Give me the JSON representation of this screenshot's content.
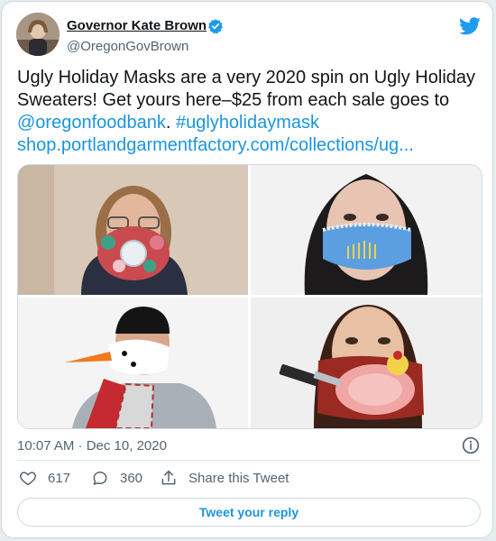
{
  "author": {
    "display_name": "Governor Kate Brown",
    "handle": "@OregonGovBrown",
    "verified": true
  },
  "icons": {
    "brand": "twitter-bird-icon",
    "verified": "verified-badge-icon",
    "info": "info-icon",
    "like": "heart-icon",
    "reply": "reply-bubble-icon",
    "share": "share-icon"
  },
  "tweet": {
    "line1": "Ugly Holiday Masks are a very 2020 spin on Ugly Holiday",
    "line2": "Sweaters! Get yours here–$25 from each sale goes to",
    "mention": "@oregonfoodbank",
    "separator": ". ",
    "hashtag": "#uglyholidaymask",
    "url": "shop.portlandgarmentfactory.com/collections/ug..."
  },
  "media": {
    "count": 4,
    "photos": [
      "photo-1",
      "photo-2",
      "photo-3",
      "photo-4"
    ]
  },
  "meta": {
    "timestamp": "10:07 AM · Dec 10, 2020"
  },
  "actions": {
    "likes": "617",
    "replies": "360",
    "share_label": "Share this Tweet"
  },
  "reply_button": {
    "label": "Tweet your reply"
  },
  "colors": {
    "link": "#1b95e0",
    "text": "#0f1419",
    "muted": "#536471",
    "border": "#cfd9de"
  }
}
